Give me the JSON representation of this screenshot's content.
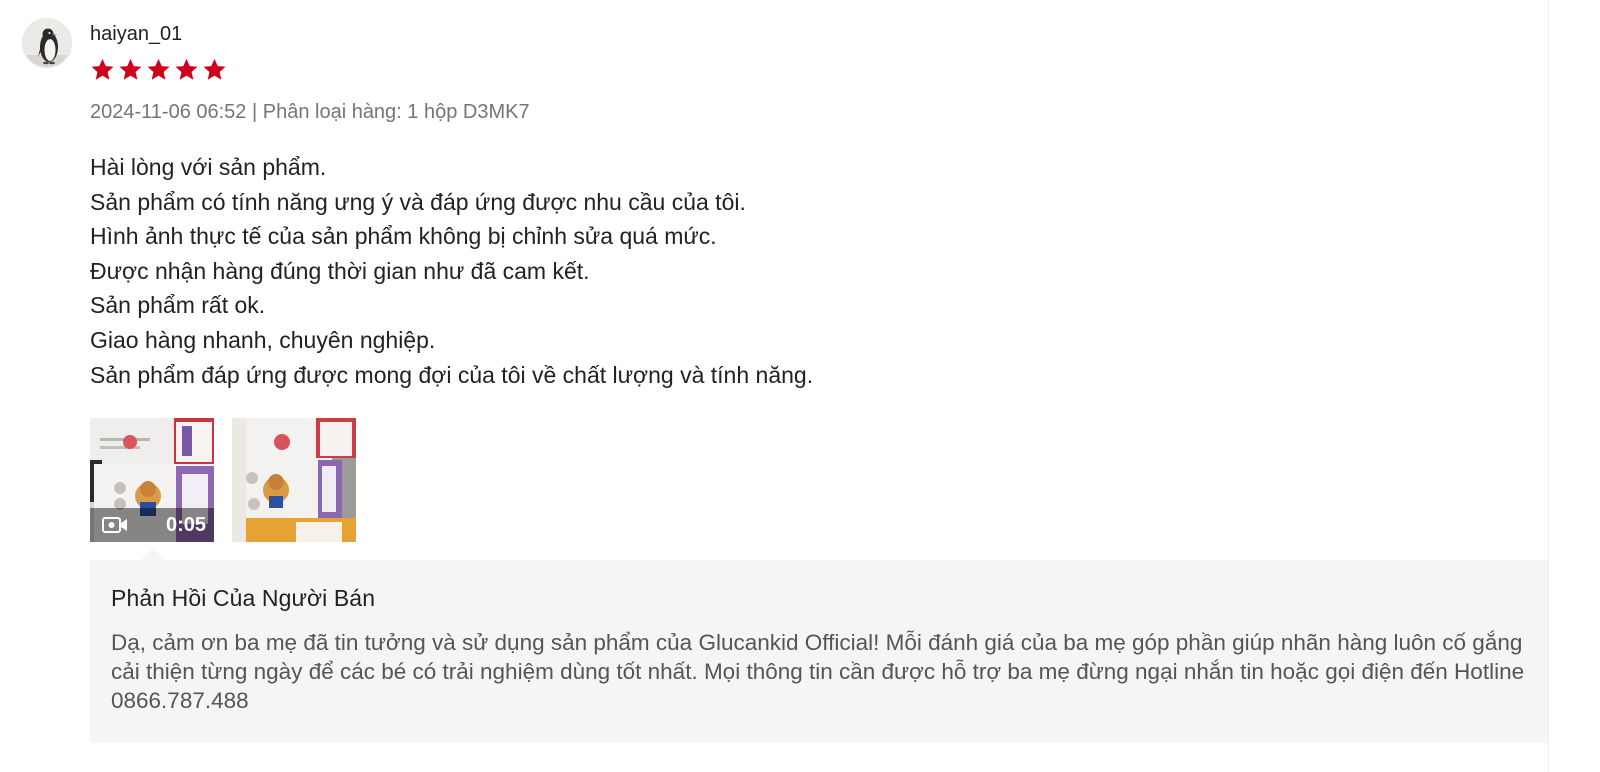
{
  "review": {
    "username": "haiyan_01",
    "rating": 5,
    "rating_max": 5,
    "star_color": "#d0011b",
    "meta": "2024-11-06 06:52 | Phân loại hàng: 1 hộp D3MK7",
    "content_lines": [
      "Hài lòng với sản phẩm.",
      "Sản phẩm có tính năng ưng ý và đáp ứng được nhu cầu của tôi.",
      "Hình ảnh thực tế của sản phẩm không bị chỉnh sửa quá mức.",
      "Được nhận hàng đúng thời gian như đã cam kết.",
      "Sản phẩm rất ok.",
      "Giao hàng nhanh, chuyên nghiệp.",
      "Sản phẩm đáp ứng được mong đợi của tôi về chất lượng và tính năng."
    ],
    "media": {
      "video_duration": "0:05",
      "video_icon": "video-camera-icon"
    }
  },
  "seller_reply": {
    "title": "Phản Hồi Của Người Bán",
    "text": "Dạ, cảm ơn ba mẹ đã tin tưởng và sử dụng sản phẩm của Glucankid Official! Mỗi đánh giá của ba mẹ góp phần giúp nhãn hàng luôn cố gắng cải thiện từng ngày để các bé có trải nghiệm dùng tốt nhất. Mọi thông tin cần được hỗ trợ ba mẹ đừng ngại nhắn tin hoặc gọi điện đến Hotline 0866.787.488"
  }
}
